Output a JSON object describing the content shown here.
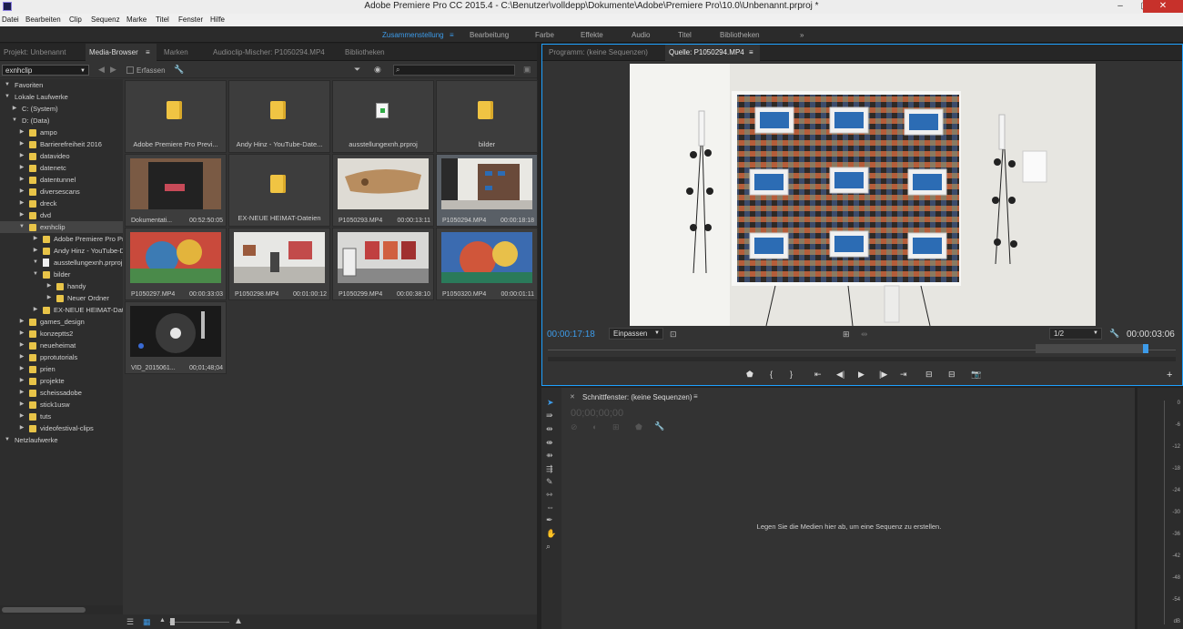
{
  "window": {
    "title": "Adobe Premiere Pro CC 2015.4 - C:\\Benutzer\\volldepp\\Dokumente\\Adobe\\Premiere Pro\\10.0\\Unbenannt.prproj *",
    "min": "–",
    "max": "▢",
    "close": "✕"
  },
  "menu": [
    "Datei",
    "Bearbeiten",
    "Clip",
    "Sequenz",
    "Marke",
    "Titel",
    "Fenster",
    "Hilfe"
  ],
  "workspaces": {
    "items": [
      "Zusammenstellung",
      "Bearbeitung",
      "Farbe",
      "Effekte",
      "Audio",
      "Titel",
      "Bibliotheken"
    ],
    "active": "Zusammenstellung",
    "more": "»"
  },
  "left_tabs": [
    "Projekt: Unbenannt",
    "Media-Browser",
    "Marken",
    "Audioclip-Mischer: P1050294.MP4",
    "Bibliotheken"
  ],
  "media_browser": {
    "location": "exnhclip",
    "ingest_label": "Erfassen",
    "tree": [
      {
        "label": "Favoriten",
        "lvl": 0,
        "tri": "open",
        "icon": "none"
      },
      {
        "label": "Lokale Laufwerke",
        "lvl": 0,
        "tri": "open",
        "icon": "none"
      },
      {
        "label": "C: (System)",
        "lvl": 1,
        "tri": "closed",
        "icon": "drive"
      },
      {
        "label": "D: (Data)",
        "lvl": 1,
        "tri": "open",
        "icon": "drive"
      },
      {
        "label": "ampo",
        "lvl": 2,
        "tri": "closed",
        "icon": "folder"
      },
      {
        "label": "Barrierefreiheit 2016",
        "lvl": 2,
        "tri": "closed",
        "icon": "folder"
      },
      {
        "label": "datavideo",
        "lvl": 2,
        "tri": "closed",
        "icon": "folder"
      },
      {
        "label": "datenetc",
        "lvl": 2,
        "tri": "closed",
        "icon": "folder"
      },
      {
        "label": "datentunnel",
        "lvl": 2,
        "tri": "closed",
        "icon": "folder"
      },
      {
        "label": "diversescans",
        "lvl": 2,
        "tri": "closed",
        "icon": "folder"
      },
      {
        "label": "dreck",
        "lvl": 2,
        "tri": "closed",
        "icon": "folder"
      },
      {
        "label": "dvd",
        "lvl": 2,
        "tri": "closed",
        "icon": "folder"
      },
      {
        "label": "exnhclip",
        "lvl": 2,
        "tri": "open",
        "icon": "folder",
        "sel": true
      },
      {
        "label": "Adobe Premiere Pro Preview Files",
        "lvl": 3,
        "tri": "closed",
        "icon": "folder"
      },
      {
        "label": "Andy Hinz - YouTube-Dateien",
        "lvl": 3,
        "tri": "closed",
        "icon": "folder"
      },
      {
        "label": "ausstellungexnh.prproj",
        "lvl": 3,
        "tri": "open",
        "icon": "file"
      },
      {
        "label": "bilder",
        "lvl": 3,
        "tri": "open",
        "icon": "folder"
      },
      {
        "label": "handy",
        "lvl": 4,
        "tri": "closed",
        "icon": "folder"
      },
      {
        "label": "Neuer Ordner",
        "lvl": 4,
        "tri": "closed",
        "icon": "folder"
      },
      {
        "label": "EX-NEUE HEIMAT-Dateien",
        "lvl": 3,
        "tri": "closed",
        "icon": "folder"
      },
      {
        "label": "games_design",
        "lvl": 2,
        "tri": "closed",
        "icon": "folder"
      },
      {
        "label": "konzeptts2",
        "lvl": 2,
        "tri": "closed",
        "icon": "folder"
      },
      {
        "label": "neueheimat",
        "lvl": 2,
        "tri": "closed",
        "icon": "folder"
      },
      {
        "label": "pprotutorials",
        "lvl": 2,
        "tri": "closed",
        "icon": "folder"
      },
      {
        "label": "prien",
        "lvl": 2,
        "tri": "closed",
        "icon": "folder"
      },
      {
        "label": "projekte",
        "lvl": 2,
        "tri": "closed",
        "icon": "folder"
      },
      {
        "label": "scheissadobe",
        "lvl": 2,
        "tri": "closed",
        "icon": "folder"
      },
      {
        "label": "stick1usw",
        "lvl": 2,
        "tri": "closed",
        "icon": "folder"
      },
      {
        "label": "tuts",
        "lvl": 2,
        "tri": "closed",
        "icon": "folder"
      },
      {
        "label": "videofestival-clips",
        "lvl": 2,
        "tri": "closed",
        "icon": "folder"
      },
      {
        "label": "Netzlaufwerke",
        "lvl": 0,
        "tri": "open",
        "icon": "none"
      }
    ],
    "tiles": [
      {
        "kind": "folder",
        "label": "Adobe Premiere Pro Previ..."
      },
      {
        "kind": "folder",
        "label": "Andy Hinz - YouTube-Date..."
      },
      {
        "kind": "file",
        "label": "ausstellungexnh.prproj"
      },
      {
        "kind": "folder",
        "label": "bilder"
      },
      {
        "kind": "clip",
        "label": "Dokumentati...",
        "dur": "00:52:50:05",
        "thumb": "shirt"
      },
      {
        "kind": "folder",
        "label": "EX-NEUE HEIMAT-Dateien"
      },
      {
        "kind": "clip",
        "label": "P1050293.MP4",
        "dur": "00:00:13:11",
        "thumb": "sculpture"
      },
      {
        "kind": "clip",
        "label": "P1050294.MP4",
        "dur": "00:00:18:18",
        "thumb": "wall",
        "sel": true
      },
      {
        "kind": "clip",
        "label": "P1050297.MP4",
        "dur": "00:00:33:03",
        "thumb": "painting"
      },
      {
        "kind": "clip",
        "label": "P1050298.MP4",
        "dur": "00:01:00:12",
        "thumb": "gallery"
      },
      {
        "kind": "clip",
        "label": "P1050299.MP4",
        "dur": "00:00:38:10",
        "thumb": "gallery2"
      },
      {
        "kind": "clip",
        "label": "P1050320.MP4",
        "dur": "00:00:01:11",
        "thumb": "painting2"
      },
      {
        "kind": "clip",
        "label": "VID_2015061...",
        "dur": "00;01;48;04",
        "thumb": "turntable"
      }
    ]
  },
  "source_tabs": [
    "Programm: (keine Sequenzen)",
    "Quelle: P1050294.MP4"
  ],
  "source": {
    "timecode": "00:00:17:18",
    "fit": "Einpassen",
    "resolution": "1/2",
    "duration": "00:00:03:06"
  },
  "timeline": {
    "tab": "Schnittfenster: (keine Sequenzen)",
    "timecode": "00;00;00;00",
    "drop_hint": "Legen Sie die Medien hier ab, um eine Sequenz zu erstellen."
  },
  "meter": {
    "ticks": [
      "0",
      "-6",
      "-12",
      "-18",
      "-24",
      "-30",
      "-36",
      "-42",
      "-48",
      "-54",
      "dB"
    ]
  }
}
